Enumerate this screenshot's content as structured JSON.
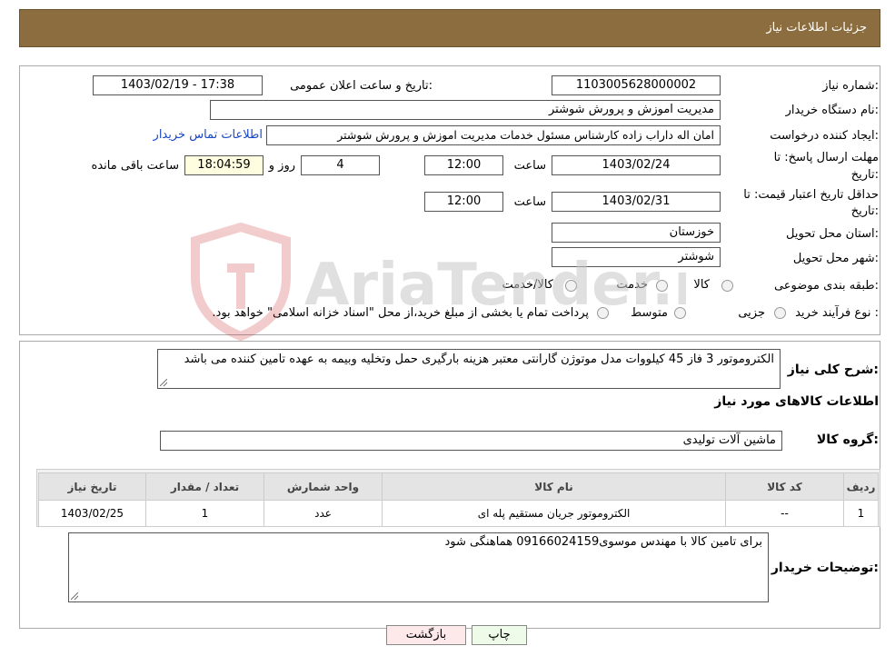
{
  "header": {
    "title": "جزئیات اطلاعات نیاز"
  },
  "fields": {
    "need_number_label": "شماره نیاز:",
    "need_number": "1103005628000002",
    "announce_label": "تاریخ و ساعت اعلان عمومی:",
    "announce_value": "1403/02/19 - 17:38",
    "buyer_org_label": "نام دستگاه خریدار:",
    "buyer_org": "مدیریت اموزش و پرورش شوشتر",
    "creator_label": "ایجاد کننده درخواست:",
    "creator": "امان اله داراب زاده کارشناس مسئول خدمات مدیریت اموزش و پرورش شوشتر",
    "contact_link": "اطلاعات تماس خریدار",
    "deadline_label_1": "مهلت ارسال پاسخ: تا",
    "deadline_label_2": "تاریخ:",
    "deadline_date": "1403/02/24",
    "time_label": "ساعت",
    "deadline_time": "12:00",
    "days_value": "4",
    "days_label": "روز و",
    "remaining_time": "18:04:59",
    "remaining_label": "ساعت باقی مانده",
    "validity_label_1": "حداقل تاریخ اعتبار قیمت: تا",
    "validity_label_2": "تاریخ:",
    "validity_date": "1403/02/31",
    "validity_time": "12:00",
    "province_label": "استان محل تحویل:",
    "province": "خوزستان",
    "city_label": "شهر محل تحویل:",
    "city": "شوشتر",
    "category_label": "طبقه بندی موضوعی:",
    "category_options": [
      "کالا",
      "خدمت",
      "کالا/خدمت"
    ],
    "process_label": "نوع فرآیند خرید :",
    "process_options": [
      "جزیی",
      "متوسط"
    ],
    "process_note": "پرداخت تمام یا بخشی از مبلغ خرید،از محل \"اسناد خزانه اسلامی\" خواهد بود."
  },
  "summary": {
    "label": "شرح کلی نیاز:",
    "text": "الکتروموتور 3 فاز 45 کیلووات مدل موتوژن گارانتی معتبر هزینه بارگیری حمل وتخلیه وبیمه به عهده تامین کننده می باشد",
    "goods_title": "اطلاعات کالاهای مورد نیاز",
    "group_label": "گروه کالا:",
    "group_value": "ماشین آلات تولیدی"
  },
  "table": {
    "headers": [
      "ردیف",
      "کد کالا",
      "نام کالا",
      "واحد شمارش",
      "تعداد / مقدار",
      "تاریخ نیاز"
    ],
    "rows": [
      [
        "1",
        "--",
        "الکتروموتور جریان مستقیم پله ای",
        "عدد",
        "1",
        "1403/02/25"
      ]
    ]
  },
  "buyer_notes": {
    "label": "توضیحات خریدار:",
    "text": "برای تامین کالا با مهندس موسوی09166024159 هماهنگی شود"
  },
  "buttons": {
    "print": "چاپ",
    "back": "بازگشت"
  },
  "watermark": {
    "text": "AriaTender.neT"
  }
}
